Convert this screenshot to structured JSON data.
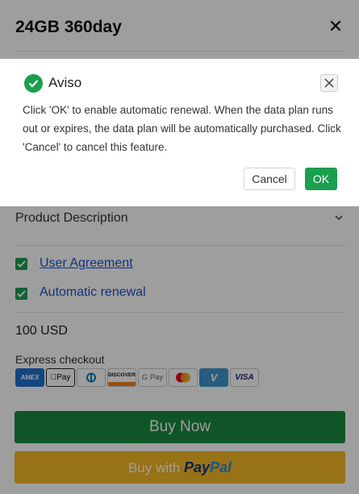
{
  "modal": {
    "title": "24GB 360day",
    "close_icon": "close-icon"
  },
  "form": {
    "product_description": "Product Description",
    "user_agreement": "User Agreement",
    "automatic_renewal": "Automatic renewal",
    "user_agreement_checked": true,
    "automatic_renewal_checked": true,
    "price": "100 USD",
    "express_checkout": "Express checkout",
    "payment_methods": [
      {
        "name": "amex-icon",
        "label": "AMEX"
      },
      {
        "name": "apple-pay-icon",
        "label": "Pay"
      },
      {
        "name": "diners-club-icon",
        "label": ""
      },
      {
        "name": "discover-icon",
        "label": "DISCOVER"
      },
      {
        "name": "google-pay-icon",
        "label": "G Pay"
      },
      {
        "name": "mastercard-icon",
        "label": ""
      },
      {
        "name": "venmo-icon",
        "label": "V"
      },
      {
        "name": "visa-icon",
        "label": "VISA"
      }
    ],
    "buy_now": "Buy Now",
    "buy_with": "Buy with",
    "paypal_pay": "Pay",
    "paypal_pal": "Pal"
  },
  "dialog": {
    "title": "Aviso",
    "message": "Click 'OK' to enable automatic renewal. When the data plan runs out or expires, the data plan will be automatically purchased. Click 'Cancel' to cancel this feature.",
    "cancel": "Cancel",
    "ok": "OK"
  },
  "colors": {
    "accent_green": "#1a9f4e",
    "buy_now_green": "#1b8a40",
    "paypal_yellow": "#f5b826",
    "link_blue": "#1a55c9"
  }
}
